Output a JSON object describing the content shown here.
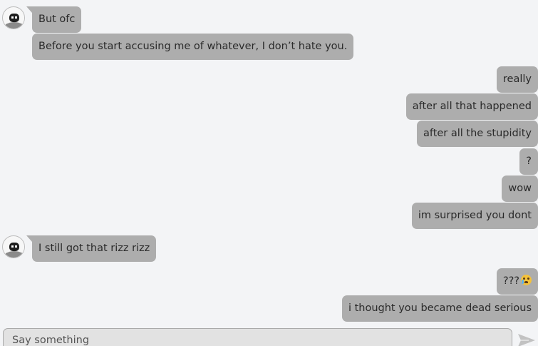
{
  "messages": [
    {
      "side": "in",
      "text": "But ofc"
    },
    {
      "side": "in",
      "text": "Before you start accusing me of whatever, I don’t hate you."
    },
    {
      "side": "out",
      "text": "really"
    },
    {
      "side": "out",
      "text": "after all that happened"
    },
    {
      "side": "out",
      "text": "after all the stupidity"
    },
    {
      "side": "out",
      "text": "?"
    },
    {
      "side": "out",
      "text": "wow"
    },
    {
      "side": "out",
      "text": "im surprised you dont"
    },
    {
      "side": "in",
      "text": "I still got that rizz rizz"
    },
    {
      "side": "out",
      "text": "???"
    },
    {
      "side": "out",
      "text": "i thought you became dead serious"
    }
  ],
  "emoji": "loudly-crying-face",
  "composer": {
    "placeholder": "Say something"
  },
  "icons": {
    "avatar": "avatar-icon",
    "send": "send-arrow-icon"
  },
  "colors": {
    "background": "#f3f4f6",
    "bubble": "#adadad",
    "text": "#2a2a2a"
  }
}
